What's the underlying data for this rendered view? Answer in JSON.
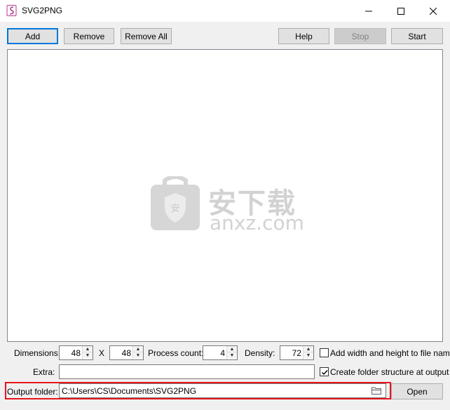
{
  "window": {
    "title": "SVG2PNG"
  },
  "toolbar": {
    "add": "Add",
    "remove": "Remove",
    "remove_all": "Remove All",
    "help": "Help",
    "stop": "Stop",
    "start": "Start"
  },
  "watermark": {
    "chinese": "安下载",
    "site": "anxz.com"
  },
  "options": {
    "dimensions_label": "Dimensions:",
    "width": "48",
    "x_label": "X",
    "height": "48",
    "process_count_label": "Process count:",
    "process_count": "4",
    "density_label": "Density:",
    "density": "72",
    "add_wh_label": "Add width and height to file name",
    "add_wh_checked": false,
    "extra_label": "Extra:",
    "extra_value": "",
    "create_structure_label": "Create folder structure at output",
    "create_structure_checked": true
  },
  "output": {
    "label": "Output folder:",
    "path": "C:\\Users\\CS\\Documents\\SVG2PNG",
    "open": "Open"
  },
  "colors": {
    "accent": "#0078d7",
    "highlight": "#e8141b"
  }
}
